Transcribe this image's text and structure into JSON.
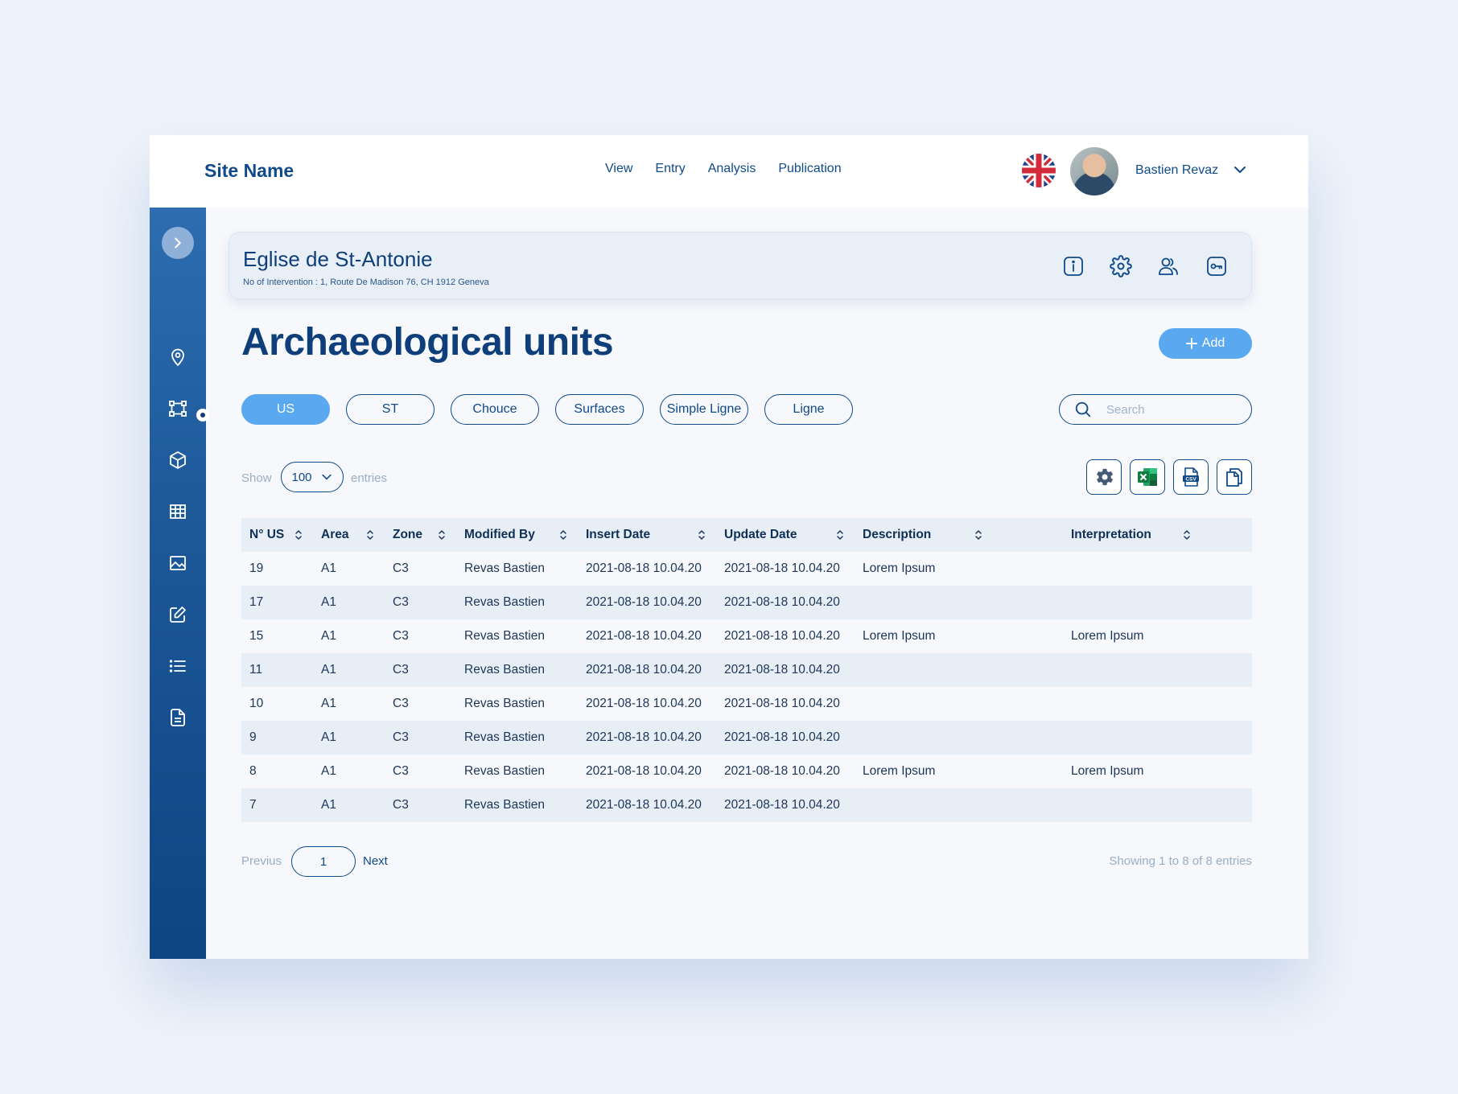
{
  "header": {
    "site_name": "Site Name",
    "nav": [
      "View",
      "Entry",
      "Analysis",
      "Publication"
    ],
    "user_name": "Bastien Revaz"
  },
  "site": {
    "title": "Eglise de St-Antonie",
    "subtitle": "No of Intervention : 1, Route De Madison 76, CH 1912 Geneva"
  },
  "page": {
    "title": "Archaeological units",
    "add_label": "Add"
  },
  "tabs": [
    "US",
    "ST",
    "Chouce",
    "Surfaces",
    "Simple Ligne",
    "Ligne"
  ],
  "active_tab": "US",
  "search": {
    "placeholder": "Search"
  },
  "length": {
    "show": "Show",
    "value": "100",
    "entries": "entries"
  },
  "table": {
    "columns": [
      "N° US",
      "Area",
      "Zone",
      "Modified By",
      "Insert Date",
      "Update Date",
      "Description",
      "Interpretation"
    ],
    "rows": [
      [
        "19",
        "A1",
        "C3",
        "Revas Bastien",
        "2021-08-18 10.04.20",
        "2021-08-18 10.04.20",
        "Lorem Ipsum",
        ""
      ],
      [
        "17",
        "A1",
        "C3",
        "Revas Bastien",
        "2021-08-18 10.04.20",
        "2021-08-18 10.04.20",
        "",
        ""
      ],
      [
        "15",
        "A1",
        "C3",
        "Revas Bastien",
        "2021-08-18 10.04.20",
        "2021-08-18 10.04.20",
        "Lorem Ipsum",
        "Lorem Ipsum"
      ],
      [
        "11",
        "A1",
        "C3",
        "Revas Bastien",
        "2021-08-18 10.04.20",
        "2021-08-18 10.04.20",
        "",
        ""
      ],
      [
        "10",
        "A1",
        "C3",
        "Revas Bastien",
        "2021-08-18 10.04.20",
        "2021-08-18 10.04.20",
        "",
        ""
      ],
      [
        "9",
        "A1",
        "C3",
        "Revas Bastien",
        "2021-08-18 10.04.20",
        "2021-08-18 10.04.20",
        "",
        ""
      ],
      [
        "8",
        "A1",
        "C3",
        "Revas Bastien",
        "2021-08-18 10.04.20",
        "2021-08-18 10.04.20",
        "Lorem Ipsum",
        "Lorem Ipsum"
      ],
      [
        "7",
        "A1",
        "C3",
        "Revas Bastien",
        "2021-08-18 10.04.20",
        "2021-08-18 10.04.20",
        "",
        ""
      ]
    ]
  },
  "pagination": {
    "previous": "Previus",
    "current": "1",
    "next": "Next",
    "info": "Showing 1 to 8 of 8 entries"
  },
  "colors": {
    "primary": "#0f4a8a",
    "accent": "#5aa8f0",
    "excel": "#1f7a44",
    "flag_blue": "#1f3f8f",
    "flag_red": "#d22b3c"
  },
  "icons": {
    "sidebar": [
      "map-pin-icon",
      "network-icon",
      "cube-icon",
      "table-icon",
      "image-icon",
      "edit-icon",
      "list-icon",
      "document-icon"
    ],
    "site_card": [
      "info-icon",
      "settings-icon",
      "users-icon",
      "key-icon"
    ],
    "export": [
      "settings-icon",
      "excel-icon",
      "csv-icon",
      "copy-icon"
    ]
  }
}
